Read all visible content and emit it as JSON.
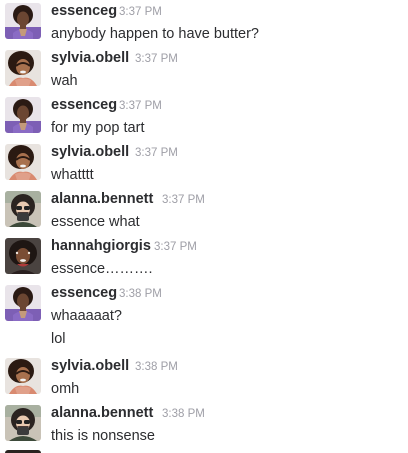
{
  "messages": [
    {
      "user": "essenceg",
      "time": "3:37 PM",
      "text": "anybody happen to have butter?",
      "avatar_icon": "essenceg-avatar"
    },
    {
      "user": "sylvia.obell",
      "time": "3:37 PM",
      "text": "wah",
      "avatar_icon": "sylvia-obell-avatar"
    },
    {
      "user": "essenceg",
      "time": "3:37 PM",
      "text": "for my pop tart",
      "avatar_icon": "essenceg-avatar"
    },
    {
      "user": "sylvia.obell",
      "time": "3:37 PM",
      "text": "whatttt",
      "avatar_icon": "sylvia-obell-avatar"
    },
    {
      "user": "alanna.bennett",
      "time": "3:37 PM",
      "text": "essence what",
      "avatar_icon": "alanna-bennett-avatar"
    },
    {
      "user": "hannahgiorgis",
      "time": "3:37 PM",
      "text": "essence……….",
      "avatar_icon": "hannahgiorgis-avatar"
    },
    {
      "user": "essenceg",
      "time": "3:38 PM",
      "text": "whaaaaat?",
      "continuation": "lol",
      "avatar_icon": "essenceg-avatar"
    },
    {
      "user": "sylvia.obell",
      "time": "3:38 PM",
      "text": "omh",
      "avatar_icon": "sylvia-obell-avatar"
    },
    {
      "user": "alanna.bennett",
      "time": "3:38 PM",
      "text": "this is nonsense",
      "avatar_icon": "alanna-bennett-avatar"
    }
  ]
}
